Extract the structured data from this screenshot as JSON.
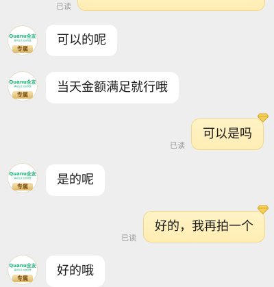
{
  "read_label": "已读",
  "avatar": {
    "brand": "Quanu全友",
    "slogan": "美好生活 全友家居",
    "tag": "专属"
  },
  "messages": {
    "m1": "可以的呢",
    "m2": "当天金额满足就行哦",
    "m3": "可以是吗",
    "m4": "是的呢",
    "m5": "好的，我再拍一个",
    "m6": "好的哦"
  }
}
